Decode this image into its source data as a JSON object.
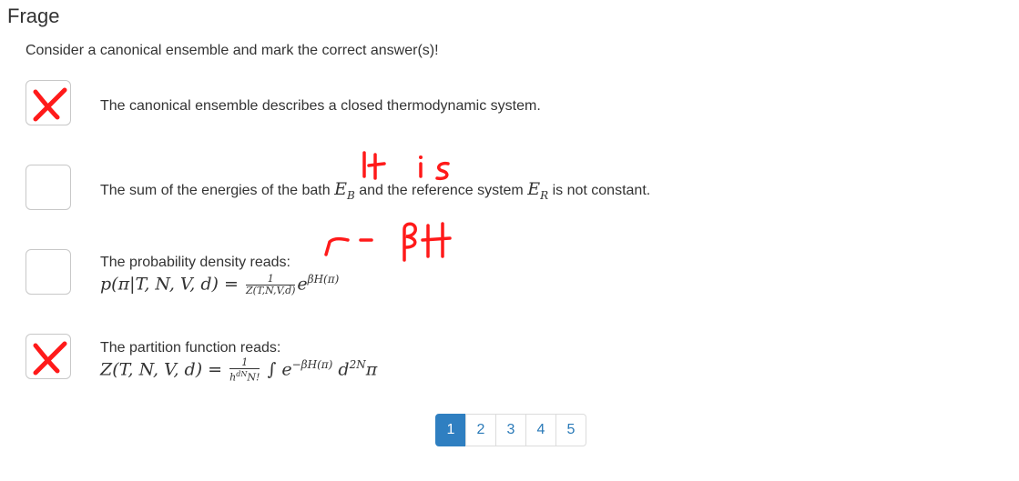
{
  "heading": "Frage",
  "prompt": "Consider a canonical ensemble and mark the correct answer(s)!",
  "options": [
    {
      "text": "The canonical ensemble describes a closed thermodynamic system.",
      "marked": true
    },
    {
      "text_pre": "The sum of the energies of the bath",
      "sym1": "E",
      "sub1": "B",
      "text_mid": "and the reference system",
      "sym2": "E",
      "sub2": "R",
      "text_post": "is not constant.",
      "marked": false
    },
    {
      "label": "The probability density reads:",
      "lhs": "p(π|T, N, V, d) =",
      "frac_num": "1",
      "frac_den": "Z(T,N,V,d)",
      "exp_base": "e",
      "exponent": "βH(π)",
      "marked": false
    },
    {
      "label": "The partition function reads:",
      "lhs": "Z(T, N, V, d) =",
      "frac_num": "1",
      "frac_den": "h",
      "frac_den_sup": "dN",
      "frac_den_tail": "N!",
      "integral": "∫ e",
      "exponent": "−βH(π)",
      "measure": "d",
      "measure_sup": "2N",
      "measure_var": "π",
      "marked": true
    }
  ],
  "annotations": {
    "it_is": "It is",
    "minus_beta_h": "- βH"
  },
  "pagination": {
    "pages": [
      "1",
      "2",
      "3",
      "4",
      "5"
    ],
    "active": "1"
  },
  "colors": {
    "annotation": "#ff1a1a",
    "active_page": "#2f7fc1",
    "link": "#2a7ab8"
  }
}
